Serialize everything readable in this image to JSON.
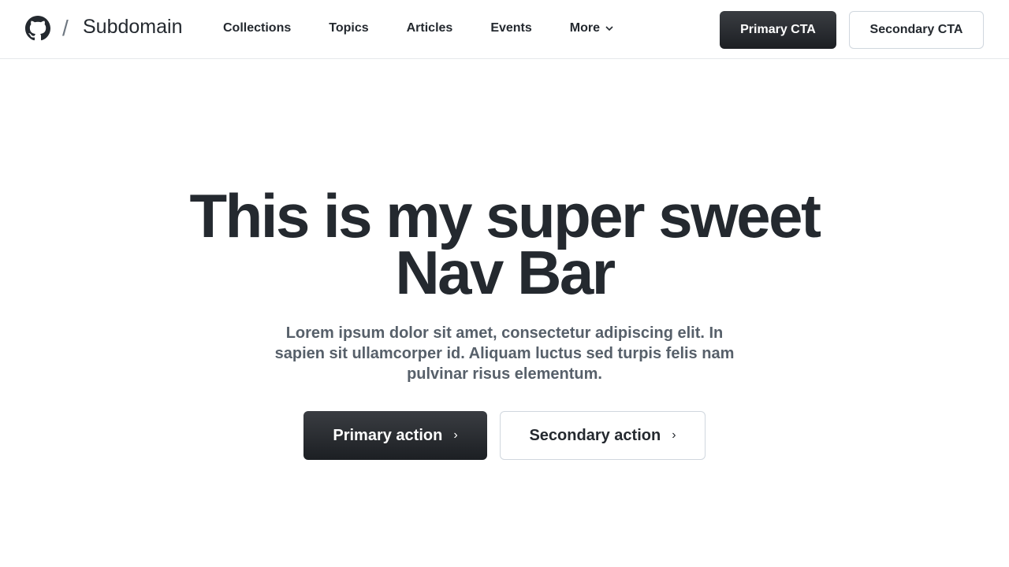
{
  "header": {
    "logo": "github-logo",
    "separator": "/",
    "subdomain": "Subdomain",
    "nav_items": [
      "Collections",
      "Topics",
      "Articles",
      "Events",
      "More"
    ],
    "primary_cta": "Primary CTA",
    "secondary_cta": "Secondary CTA"
  },
  "hero": {
    "title_line1": "This is my super sweet",
    "title_line2": "Nav Bar",
    "description": "Lorem ipsum dolor sit amet, consectetur adipiscing elit. In sapien sit ullamcorper id. Aliquam luctus sed turpis felis nam pulvinar risus elementum.",
    "primary_action": "Primary action",
    "secondary_action": "Secondary action",
    "chevron": "›"
  }
}
